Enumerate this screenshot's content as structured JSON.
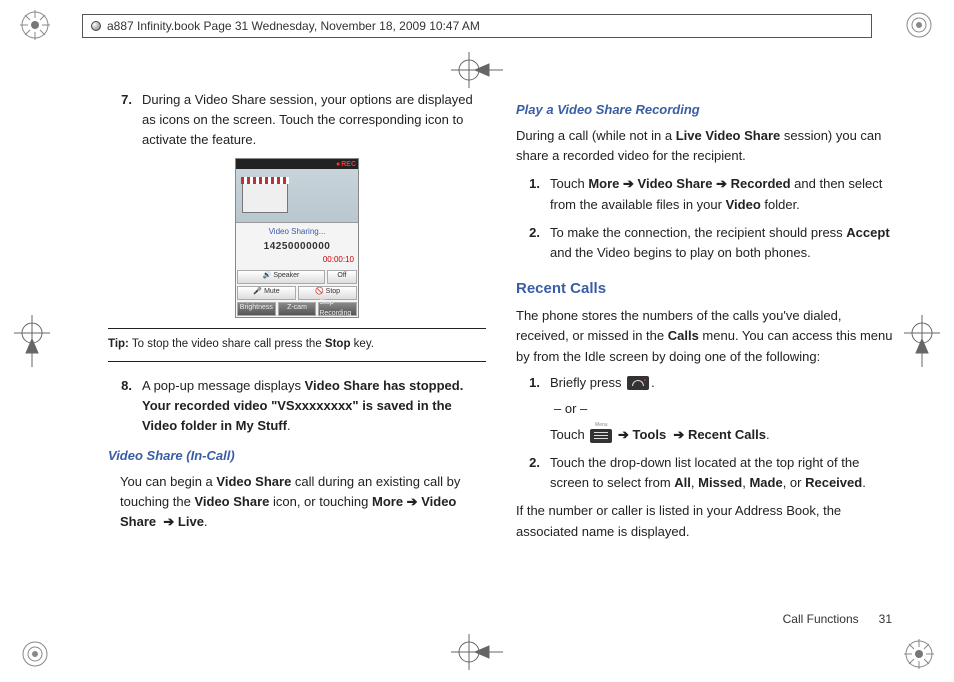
{
  "header": "a887 Infinity.book  Page 31  Wednesday, November 18, 2009  10:47 AM",
  "left": {
    "step7_num": "7.",
    "step7": "During a Video Share session, your options are displayed as icons on the screen. Touch the corresponding icon to activate the feature.",
    "phone": {
      "rec": "REC",
      "label": "Video Sharing...",
      "number": "14250000000",
      "timer": "00:00:10",
      "speaker": "Speaker",
      "off": "Off",
      "mute": "Mute",
      "stop": "Stop",
      "brightness": "Brightness",
      "zoom": "Z-cam",
      "stoprec": "Stop Recording"
    },
    "tip_label": "Tip:",
    "tip_a": " To stop the video share call press the ",
    "tip_b": "Stop",
    "tip_c": " key.",
    "step8_num": "8.",
    "step8_a": "A pop-up message displays ",
    "step8_b": "Video Share has stopped. Your recorded video \"VSxxxxxxxx\" is saved in the Video folder in My Stuff",
    "step8_c": ".",
    "sub1": "Video Share (In-Call)",
    "incall_a": "You can begin a ",
    "incall_b": "Video Share",
    "incall_c": " call during an existing call by touching the ",
    "incall_d": "Video Share",
    "incall_e": " icon, or touching ",
    "incall_f": "More",
    "incall_g": "Video Share",
    "incall_h": "Live",
    "incall_i": "."
  },
  "right": {
    "sub2": "Play a Video Share Recording",
    "play_a": "During a call (while not in a ",
    "play_b": "Live Video Share",
    "play_c": " session) you can share a recorded video for the recipient.",
    "r1_num": "1.",
    "r1_a": "Touch ",
    "r1_b": "More",
    "r1_c": "Video Share",
    "r1_d": "Recorded",
    "r1_e": " and then select from the available files in your ",
    "r1_f": "Video",
    "r1_g": " folder.",
    "r2_num": "2.",
    "r2_a": "To make the connection, the recipient should press ",
    "r2_b": "Accept",
    "r2_c": " and the Video begins to play on both phones.",
    "section": "Recent Calls",
    "recent_a": "The phone stores the numbers of the calls you've dialed, received, or missed in the ",
    "recent_b": "Calls",
    "recent_c": " menu. You can access this menu by from the Idle screen by doing one of the following:",
    "rc1_num": "1.",
    "rc1_a": "Briefly press ",
    "rc1_b": ".",
    "or": "– or –",
    "rc1_c": "Touch ",
    "rc1_d": "Tools",
    "rc1_e": "Recent Calls",
    "rc1_f": ".",
    "rc2_num": "2.",
    "rc2_a": "Touch the drop-down list located at the top right of the screen to select from ",
    "rc2_b": "All",
    "rc2_c": "Missed",
    "rc2_d": "Made",
    "rc2_e": "Received",
    "rc2_f": ".",
    "closing": "If the number or caller is listed in your Address Book, the associated name is displayed."
  },
  "footer": {
    "section": "Call Functions",
    "page": "31"
  },
  "arrow": "➔"
}
